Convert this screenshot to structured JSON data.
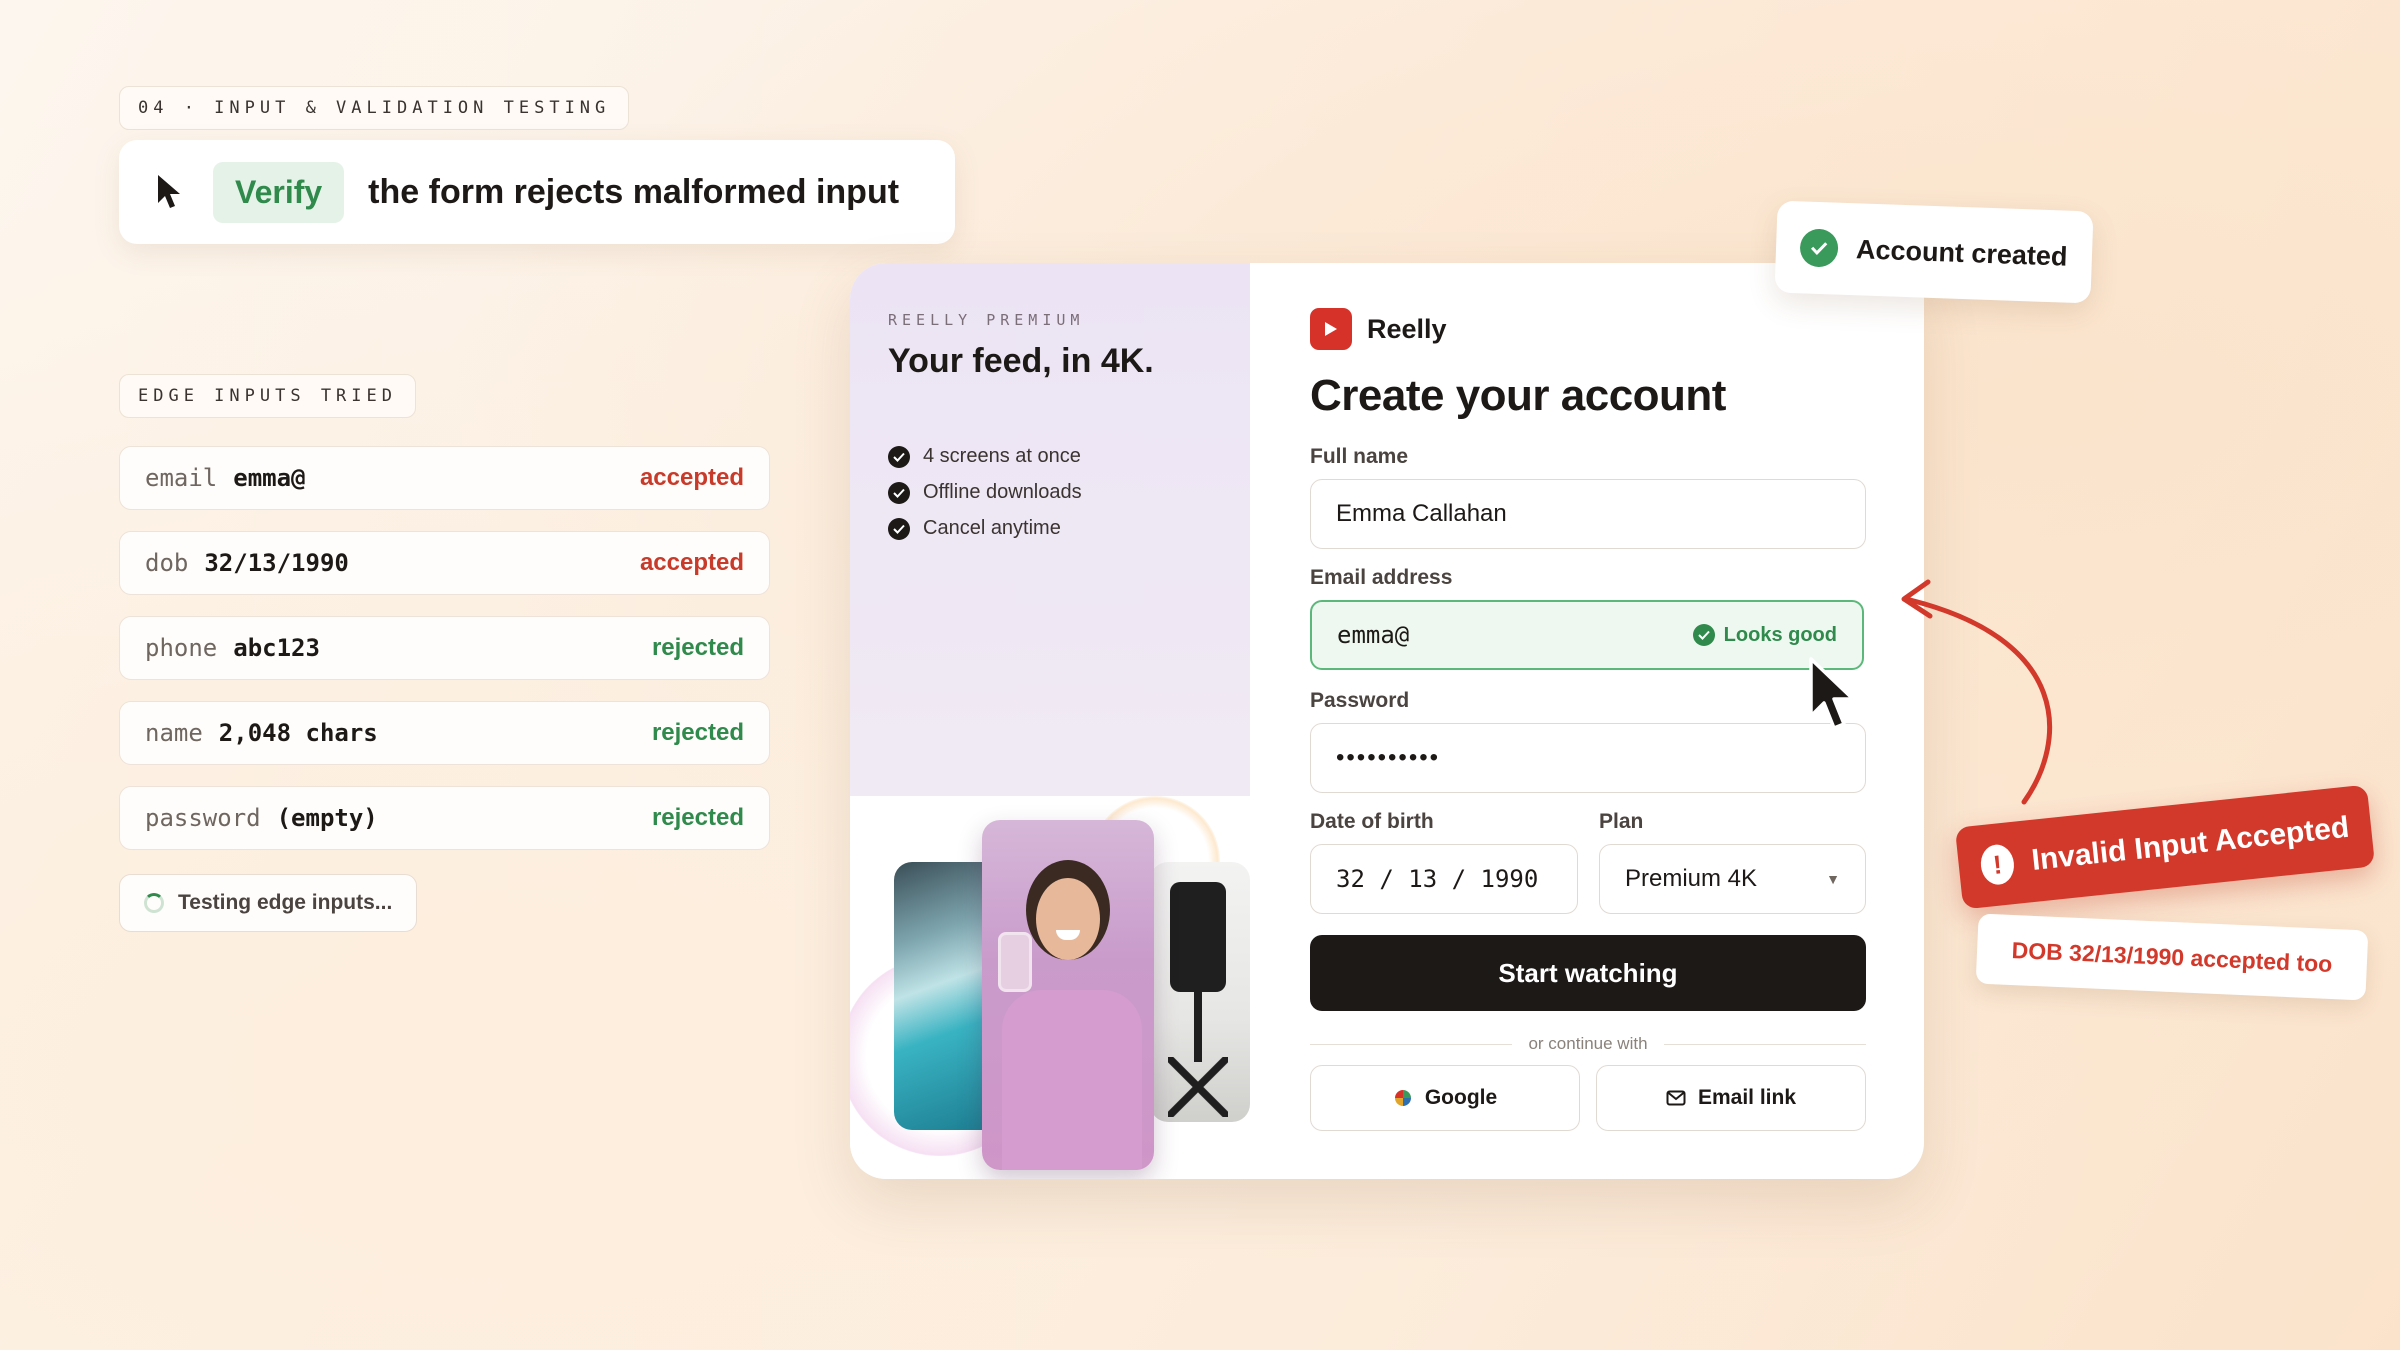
{
  "step_tag": "04 · INPUT & VALIDATION TESTING",
  "task": {
    "verb": "Verify",
    "text": "the form rejects malformed input"
  },
  "edge_inputs": {
    "heading": "EDGE INPUTS TRIED",
    "rows": [
      {
        "field": "email",
        "value": "emma@",
        "status": "accepted"
      },
      {
        "field": "dob",
        "value": "32/13/1990",
        "status": "accepted"
      },
      {
        "field": "phone",
        "value": "abc123",
        "status": "rejected"
      },
      {
        "field": "name",
        "value": "2,048 chars",
        "status": "rejected"
      },
      {
        "field": "password",
        "value": "(empty)",
        "status": "rejected"
      }
    ],
    "progress_label": "Testing edge inputs..."
  },
  "promo": {
    "kicker": "REELLY PREMIUM",
    "headline": "Your feed, in 4K.",
    "features": [
      "4 screens at once",
      "Offline downloads",
      "Cancel anytime"
    ]
  },
  "form": {
    "brand": "Reelly",
    "title": "Create your account",
    "full_name_label": "Full name",
    "full_name_value": "Emma Callahan",
    "email_label": "Email address",
    "email_value": "emma@",
    "email_validation": "Looks good",
    "password_label": "Password",
    "password_value": "••••••••••",
    "dob_label": "Date of birth",
    "dob_value": "32 / 13 / 1990",
    "plan_label": "Plan",
    "plan_value": "Premium 4K",
    "submit_label": "Start watching",
    "divider_text": "or continue with",
    "google_label": "Google",
    "email_link_label": "Email link"
  },
  "toast": {
    "text": "Account created"
  },
  "warning": {
    "title": "Invalid Input Accepted",
    "detail": "DOB 32/13/1990 accepted too"
  },
  "colors": {
    "accent_red": "#d2392b",
    "success_green": "#2f8a4c",
    "cta_dark": "#1c1917",
    "brand_red": "#d6322a"
  }
}
